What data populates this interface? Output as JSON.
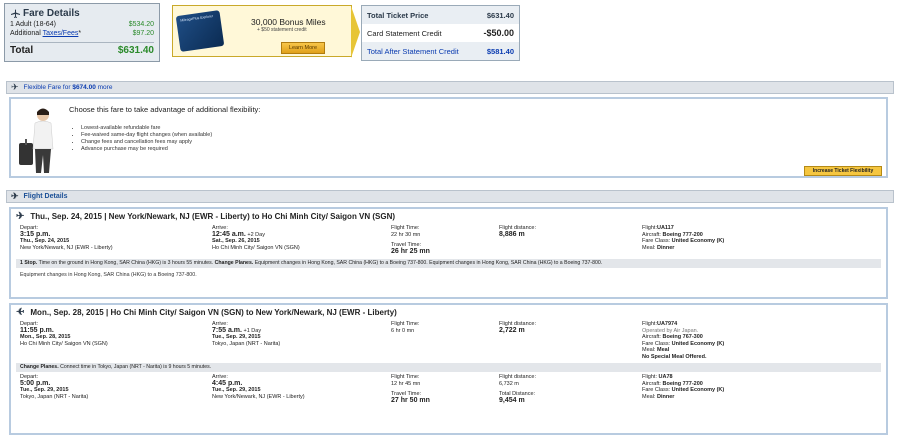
{
  "fare": {
    "title": "Fare Details",
    "adult_label": "1 Adult (18-64)",
    "adult_price": "$534.20",
    "additional_prefix": "Additional ",
    "taxes_link": "Taxes/Fees",
    "taxes_suffix": "*",
    "taxes_price": "$97.20",
    "total_label": "Total",
    "total_price": "$631.40"
  },
  "promo": {
    "card_text": "MileagePlus Explorer",
    "headline": "30,000 Bonus Miles",
    "sub": "+ $50 statement credit",
    "button": "Learn More"
  },
  "price": {
    "ticket_label": "Total Ticket Price",
    "ticket_value": "$631.40",
    "credit_label": "Card Statement Credit",
    "credit_value": "-$50.00",
    "after_label": "Total After Statement Credit",
    "after_value": "$581.40"
  },
  "flex": {
    "bar_prefix": "Flexible Fare for ",
    "bar_amount": "$674.00",
    "bar_suffix": " more",
    "heading": "Choose this fare to take advantage of additional flexibility:",
    "bullets": [
      "Lowest-available refundable fare",
      "Fee-waived same-day flight changes (when available)",
      "Change fees and cancellation fees may apply",
      "Advance purchase may be required"
    ],
    "button": "Increase Ticket Flexibility"
  },
  "details_title": "Flight Details",
  "flight1": {
    "header": "Thu., Sep. 24, 2015 | New York/Newark, NJ (EWR - Liberty) to Ho Chi Minh City/ Saigon VN (SGN)",
    "depart_label": "Depart:",
    "depart_time": "3:15 p.m.",
    "depart_date": "Thu., Sep. 24, 2015",
    "depart_airport": "New York/Newark, NJ (EWR - Liberty)",
    "arrive_label": "Arrive:",
    "arrive_time": "12:45 a.m.",
    "arrive_plus": " +2 Day",
    "arrive_date": "Sat., Sep. 26, 2015",
    "arrive_airport": "Ho Chi Minh City/ Saigon VN (SGN)",
    "flight_time_label": "Flight Time:",
    "flight_time": "22 hr 30 mn",
    "travel_time_label": "Travel Time:",
    "travel_time": "26 hr 25 mn",
    "distance_label": "Flight distance:",
    "distance": "8,886 m",
    "flight_label": "Flight:",
    "flight_no": "UA117",
    "aircraft_label": "Aircraft: ",
    "aircraft": "Boeing 777-200",
    "class_label": "Fare Class: ",
    "fare_class": "United Economy (K)",
    "meal_label": "Meal: ",
    "meal": "Dinner",
    "stop_a": "1 Stop.",
    "stop_b": " Time on the ground in Hong Kong, SAR China (HKG) is 3 hours 55 minutes. ",
    "stop_c": "Change Planes.",
    "stop_d": " Equipment changes in Hong Kong, SAR China (HKG) to a Boeing 737-800. Equipment changes in Hong Kong, SAR China (HKG) to a Boeing 737-800.",
    "note": "Equipment changes in Hong Kong, SAR China (HKG) to a Boeing 737-800."
  },
  "flight2": {
    "header": "Mon., Sep. 28, 2015 | Ho Chi Minh City/ Saigon VN (SGN) to New York/Newark, NJ (EWR - Liberty)",
    "s1": {
      "depart_label": "Depart:",
      "depart_time": "11:55 p.m.",
      "depart_date": "Mon., Sep. 28, 2015",
      "depart_airport": "Ho Chi Minh City/ Saigon VN (SGN)",
      "arrive_label": "Arrive:",
      "arrive_time": "7:55 a.m.",
      "arrive_plus": " +1 Day",
      "arrive_date": "Tue., Sep. 29, 2015",
      "arrive_airport": "Tokyo, Japan (NRT - Narita)",
      "flight_time_label": "Flight Time:",
      "flight_time": "6 hr 0 mn",
      "distance_label": "Flight distance:",
      "distance": "2,722 m",
      "flight_label": "Flight:",
      "flight_no": "UA7974",
      "operated": "Operated by Air Japan.",
      "aircraft_label": "Aircraft: ",
      "aircraft": "Boeing 767-300",
      "class_label": "Fare Class: ",
      "fare_class": "United Economy (K)",
      "meal_label": "Meal: ",
      "meal": "Meal",
      "special_meal": "No Special Meal Offered."
    },
    "stop_a": "Change Planes.",
    "stop_b": " Connect time in Tokyo, Japan (NRT - Narita) is 9 hours 5 minutes.",
    "s2": {
      "depart_label": "Depart:",
      "depart_time": "5:00 p.m.",
      "depart_date": "Tue., Sep. 29, 2015",
      "depart_airport": "Tokyo, Japan (NRT - Narita)",
      "arrive_label": "Arrive:",
      "arrive_time": "4:45 p.m.",
      "arrive_date": "Tue., Sep. 29, 2015",
      "arrive_airport": "New York/Newark, NJ (EWR - Liberty)",
      "flight_time_label": "Flight Time:",
      "flight_time": "12 hr 45 mn",
      "travel_time_label": "Travel Time:",
      "travel_time": "27 hr 50 mn",
      "distance_label": "Flight distance:",
      "distance": "6,732 m",
      "total_distance_label": "Total Distance:",
      "total_distance": "9,454 m",
      "flight_label": "Flight: ",
      "flight_no": "UA78",
      "aircraft_label": "Aircraft: ",
      "aircraft": "Boeing 777-200",
      "class_label": "Fare Class: ",
      "fare_class": "United Economy (K)",
      "meal_label": "Meal: ",
      "meal": "Dinner"
    }
  }
}
